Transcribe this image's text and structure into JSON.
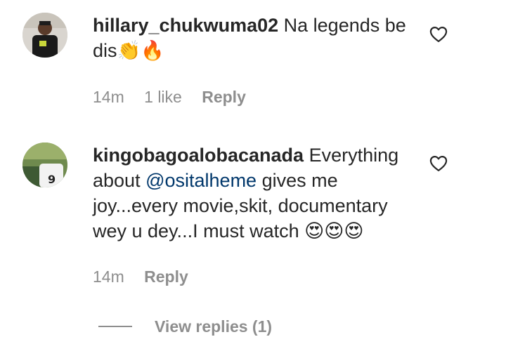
{
  "comments": [
    {
      "username": "hillary_chukwuma02",
      "text_parts": [
        "Na legends be dis",
        "👏🔥"
      ],
      "time": "14m",
      "likes": "1 like",
      "reply_label": "Reply",
      "heart_icon": "heart-outline-icon",
      "avatar_icon": "user-avatar"
    },
    {
      "username": "kingobagoalobacanada",
      "text_before": "Everything about",
      "mention": "@ositalheme",
      "text_after": "gives me joy...every movie,skit, documentary wey u dey...I must watch",
      "emojis": "😍😍😍",
      "time": "14m",
      "reply_label": "Reply",
      "heart_icon": "heart-outline-icon",
      "avatar_icon": "user-avatar"
    }
  ],
  "view_replies": "View replies (1)",
  "colors": {
    "text": "#262626",
    "muted": "#8e8e8e",
    "mention": "#00376b"
  }
}
